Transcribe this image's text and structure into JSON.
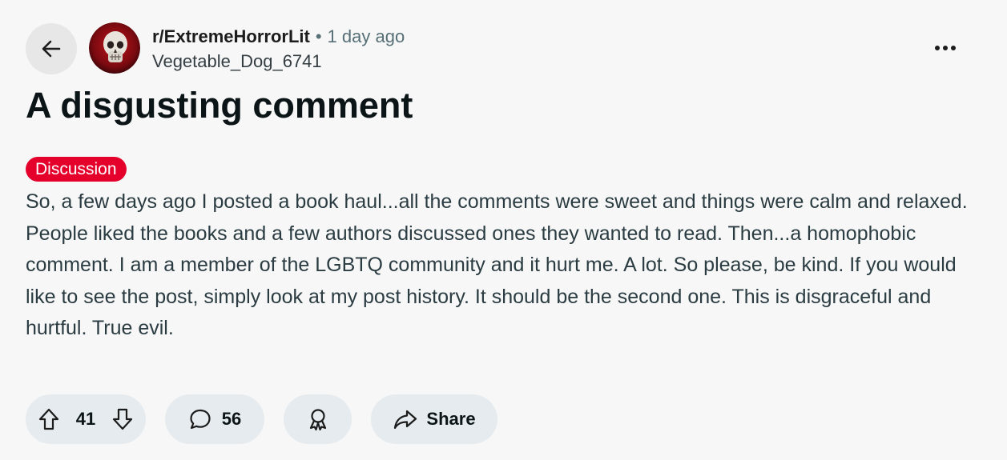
{
  "post": {
    "subreddit": "r/ExtremeHorrorLit",
    "separator": "•",
    "time_ago": "1 day ago",
    "author": "Vegetable_Dog_6741",
    "title": "A disgusting comment",
    "flair": "Discussion",
    "body": "So, a few days ago I posted a book haul...all the comments were sweet and things were calm and relaxed. People liked the books and a few authors discussed ones they wanted to read. Then...a homophobic comment. I am a member of the LGBTQ community and it hurt me. A lot. So please, be kind. If you would like to see the post, simply look at my post history. It should be the second one. This is disgraceful and hurtful. True evil."
  },
  "actions": {
    "vote_count": "41",
    "comment_count": "56",
    "share_label": "Share"
  },
  "icons": {
    "back": "arrow-left-icon",
    "overflow": "ellipsis-icon",
    "upvote": "arrow-up-icon",
    "downvote": "arrow-down-icon",
    "comment": "speech-bubble-icon",
    "award": "award-ribbon-icon",
    "share": "share-arrow-icon",
    "avatar": "skull-avatar"
  },
  "colors": {
    "background": "#f7f7f7",
    "flair_background": "#e4002b",
    "flair_text": "#ffffff",
    "pill_background": "#e5ebee"
  }
}
